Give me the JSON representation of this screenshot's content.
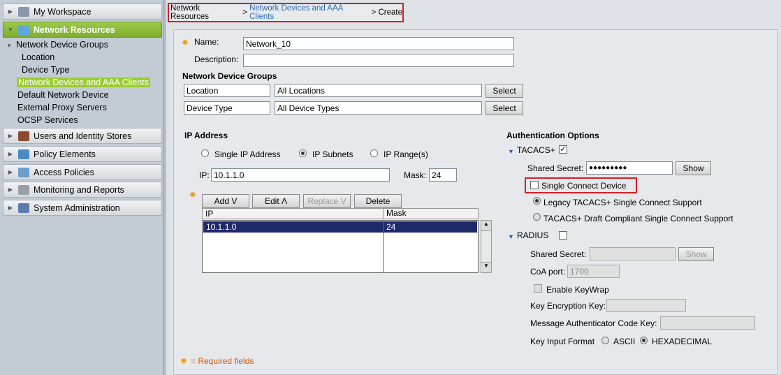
{
  "sidebar": {
    "sections": [
      {
        "label": "My Workspace",
        "icon": "workspace-icon"
      },
      {
        "label": "Network Resources",
        "icon": "network-icon"
      },
      {
        "label": "Users and Identity Stores",
        "icon": "users-icon"
      },
      {
        "label": "Policy Elements",
        "icon": "policy-icon"
      },
      {
        "label": "Access Policies",
        "icon": "access-icon"
      },
      {
        "label": "Monitoring and Reports",
        "icon": "monitor-icon"
      },
      {
        "label": "System Administration",
        "icon": "admin-icon"
      }
    ],
    "items": [
      "Network Device Groups",
      "Location",
      "Device Type",
      "Network Devices and AAA Clients",
      "Default Network Device",
      "External Proxy Servers",
      "OCSP Services"
    ]
  },
  "breadcrumb": {
    "root": "Network Resources",
    "sep": ">",
    "parent": "Network Devices and AAA Clients",
    "current": "Create"
  },
  "form": {
    "name_label": "Name:",
    "name_value": "Network_10",
    "desc_label": "Description:",
    "desc_value": "",
    "ndg_title": "Network Device Groups",
    "ndg": [
      {
        "label": "Location",
        "value": "All Locations",
        "button": "Select"
      },
      {
        "label": "Device Type",
        "value": "All Device Types",
        "button": "Select"
      }
    ],
    "ip_title": "IP Address",
    "ip_modes": [
      "Single IP Address",
      "IP Subnets",
      "IP Range(s)"
    ],
    "ip_label": "IP:",
    "ip_value": "10.1.1.0",
    "mask_label": "Mask:",
    "mask_value": "24",
    "buttons": [
      "Add V",
      "Edit Λ",
      "Replace V",
      "Delete"
    ],
    "table": {
      "headers": [
        "IP",
        "Mask"
      ],
      "rows": [
        [
          "10.1.1.0",
          "24"
        ]
      ]
    },
    "required_note": "= Required fields"
  },
  "auth": {
    "title": "Authentication Options",
    "tacacs_label": "TACACS+",
    "shared_secret_label": "Shared Secret:",
    "shared_secret_value": "●●●●●●●●●",
    "show": "Show",
    "single_connect": "Single Connect Device",
    "legacy": "Legacy TACACS+ Single Connect Support",
    "draft": "TACACS+ Draft Compliant Single Connect Support",
    "radius_label": "RADIUS",
    "radius_secret_label": "Shared Secret:",
    "radius_show": "Show",
    "coa_label": "CoA port:",
    "coa_value": "1700",
    "keywrap": "Enable KeyWrap",
    "kek_label": "Key Encryption Key:",
    "mack_label": "Message Authenticator Code Key:",
    "key_format_label": "Key Input Format",
    "ascii": "ASCII",
    "hex": "HEXADECIMAL"
  }
}
